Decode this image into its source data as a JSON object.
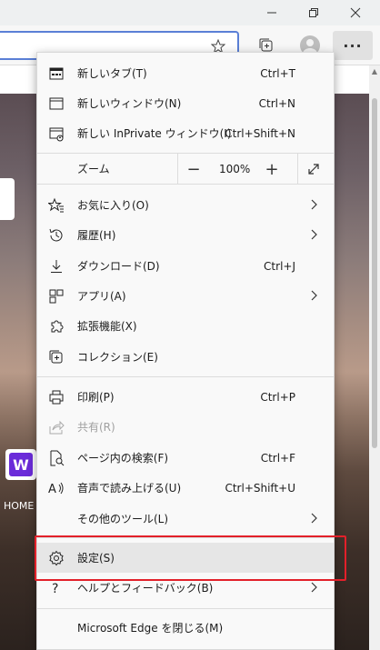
{
  "window_controls": {
    "minimize_icon": "minimize-icon",
    "maximize_icon": "restore-icon",
    "close_icon": "close-icon"
  },
  "toolbar": {
    "favorite_icon": "star-icon",
    "collections_icon": "collections-icon",
    "profile_icon": "profile-avatar",
    "more_label": "···"
  },
  "page": {
    "tile_letter": "W",
    "home_text": "HOME"
  },
  "menu": {
    "new_tab": {
      "label": "新しいタブ(T)",
      "shortcut": "Ctrl+T"
    },
    "new_window": {
      "label": "新しいウィンドウ(N)",
      "shortcut": "Ctrl+N"
    },
    "new_inprivate": {
      "label": "新しい InPrivate ウィンドウ(I)",
      "shortcut": "Ctrl+Shift+N"
    },
    "zoom": {
      "label": "ズーム",
      "minus": "−",
      "value": "100%",
      "plus": "+"
    },
    "favorites": {
      "label": "お気に入り(O)"
    },
    "history": {
      "label": "履歴(H)"
    },
    "downloads": {
      "label": "ダウンロード(D)",
      "shortcut": "Ctrl+J"
    },
    "apps": {
      "label": "アプリ(A)"
    },
    "extensions": {
      "label": "拡張機能(X)"
    },
    "collections": {
      "label": "コレクション(E)"
    },
    "print": {
      "label": "印刷(P)",
      "shortcut": "Ctrl+P"
    },
    "share": {
      "label": "共有(R)"
    },
    "find": {
      "label": "ページ内の検索(F)",
      "shortcut": "Ctrl+F"
    },
    "read_aloud": {
      "label": "音声で読み上げる(U)",
      "shortcut": "Ctrl+Shift+U"
    },
    "more_tools": {
      "label": "その他のツール(L)"
    },
    "settings": {
      "label": "設定(S)"
    },
    "help": {
      "label": "ヘルプとフィードバック(B)"
    },
    "close": {
      "label": "Microsoft Edge を閉じる(M)"
    }
  },
  "colors": {
    "highlight_box": "#e3202a",
    "accent": "#5a7fd6",
    "tile": "#6b2bd9"
  }
}
